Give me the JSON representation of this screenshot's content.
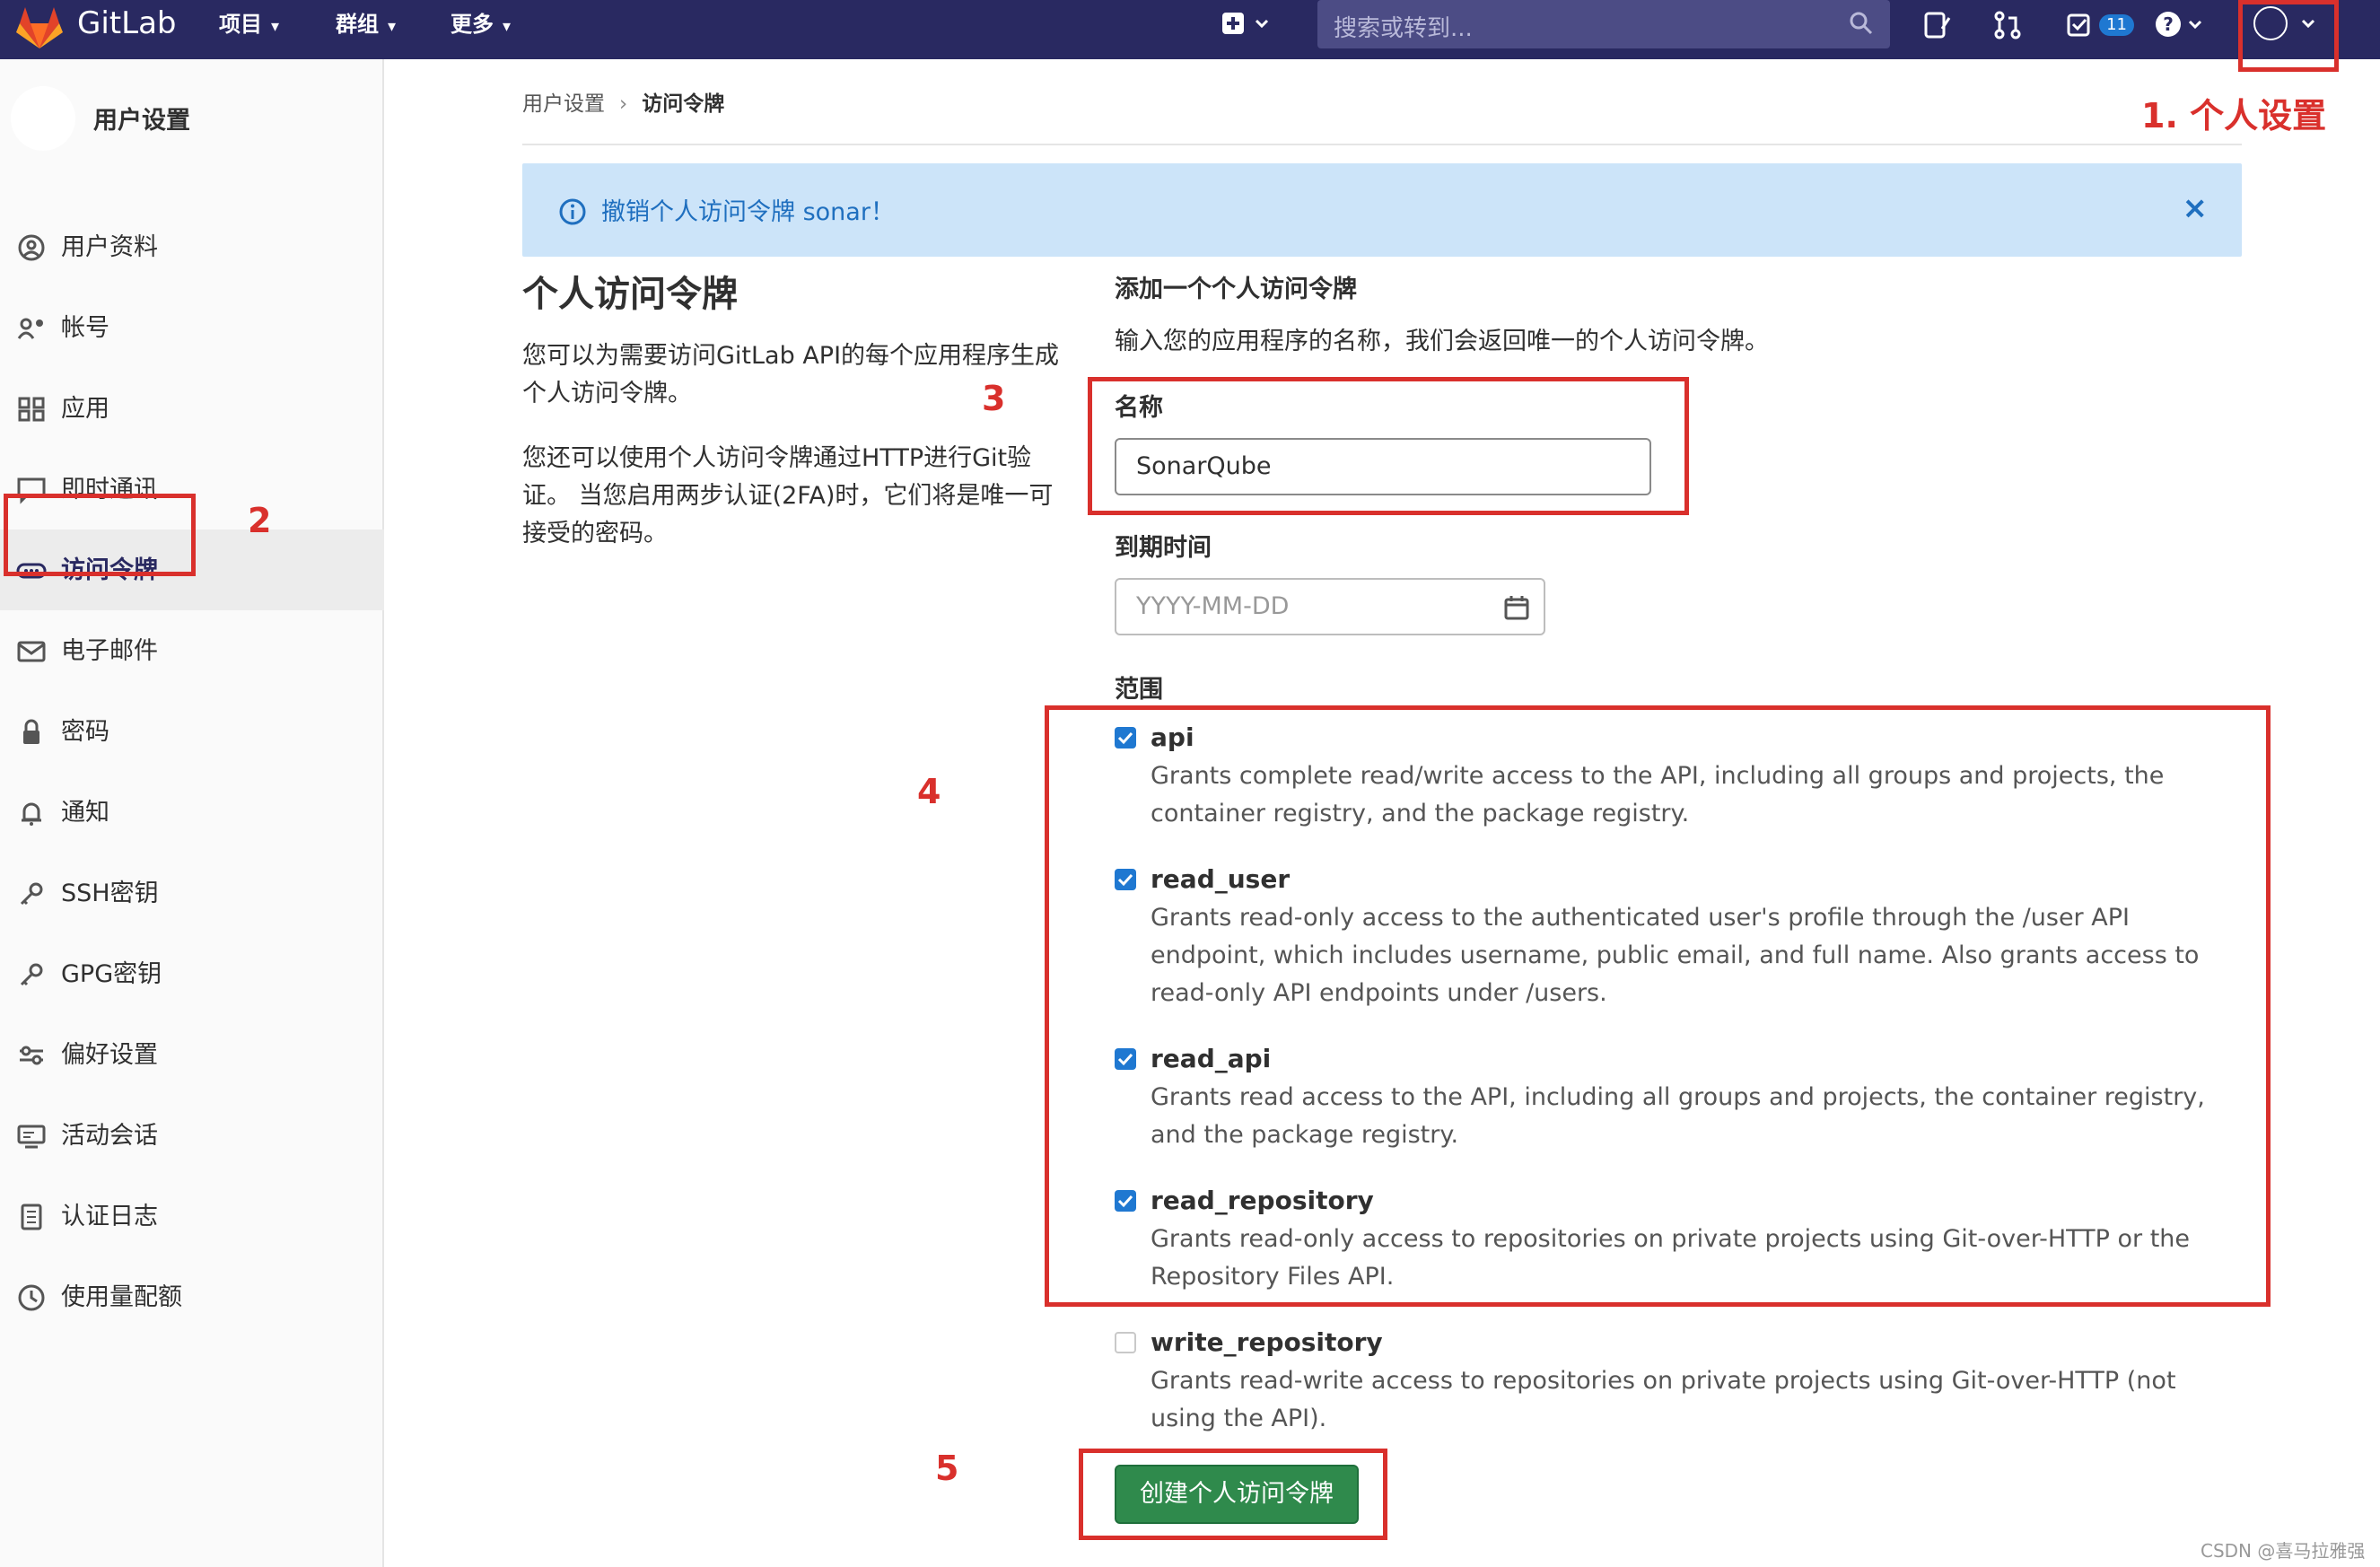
{
  "navbar": {
    "brand": "GitLab",
    "menus": [
      "项目",
      "群组",
      "更多"
    ],
    "search_placeholder": "搜索或转到...",
    "todo_count": "11"
  },
  "sidebar": {
    "title": "用户设置",
    "items": [
      {
        "label": "用户资料",
        "icon": "user-circle-icon"
      },
      {
        "label": "帐号",
        "icon": "account-gear-icon"
      },
      {
        "label": "应用",
        "icon": "apps-grid-icon"
      },
      {
        "label": "即时通讯",
        "icon": "chat-icon"
      },
      {
        "label": "访问令牌",
        "icon": "token-icon",
        "active": true
      },
      {
        "label": "电子邮件",
        "icon": "mail-icon"
      },
      {
        "label": "密码",
        "icon": "lock-icon"
      },
      {
        "label": "通知",
        "icon": "bell-icon"
      },
      {
        "label": "SSH密钥",
        "icon": "key-icon"
      },
      {
        "label": "GPG密钥",
        "icon": "key-icon"
      },
      {
        "label": "偏好设置",
        "icon": "sliders-icon"
      },
      {
        "label": "活动会话",
        "icon": "monitor-icon"
      },
      {
        "label": "认证日志",
        "icon": "log-icon"
      },
      {
        "label": "使用量配额",
        "icon": "quota-icon"
      }
    ]
  },
  "breadcrumb": {
    "parent": "用户设置",
    "current": "访问令牌"
  },
  "flash": {
    "message": "撤销个人访问令牌 sonar！",
    "close": "×"
  },
  "intro": {
    "heading": "个人访问令牌",
    "para1": "您可以为需要访问GitLab API的每个应用程序生成个人访问令牌。",
    "para2": "您还可以使用个人访问令牌通过HTTP进行Git验证。 当您启用两步认证(2FA)时，它们将是唯一可接受的密码。"
  },
  "form": {
    "title": "添加一个个人访问令牌",
    "description": "输入您的应用程序的名称，我们会返回唯一的个人访问令牌。",
    "name_label": "名称",
    "name_value": "SonarQube",
    "expires_label": "到期时间",
    "expires_placeholder": "YYYY-MM-DD",
    "scopes_label": "范围",
    "scopes": [
      {
        "name": "api",
        "checked": true,
        "desc": "Grants complete read/write access to the API, including all groups and projects, the container registry, and the package registry."
      },
      {
        "name": "read_user",
        "checked": true,
        "desc": "Grants read-only access to the authenticated user's profile through the /user API endpoint, which includes username, public email, and full name. Also grants access to read-only API endpoints under /users."
      },
      {
        "name": "read_api",
        "checked": true,
        "desc": "Grants read access to the API, including all groups and projects, the container registry, and the package registry."
      },
      {
        "name": "read_repository",
        "checked": true,
        "desc": "Grants read-only access to repositories on private projects using Git-over-HTTP or the Repository Files API."
      },
      {
        "name": "write_repository",
        "checked": false,
        "desc": "Grants read-write access to repositories on private projects using Git-over-HTTP (not using the API)."
      }
    ],
    "submit_label": "创建个人访问令牌"
  },
  "annotations": {
    "a1": "1. 个人设置",
    "a2": "2",
    "a3": "3",
    "a4": "4",
    "a5": "5"
  },
  "watermark": "CSDN @喜马拉雅强",
  "colors": {
    "navbar": "#292961",
    "flash_bg": "#cce4f9",
    "submit": "#2f8a4c",
    "annotation": "#d9302c",
    "checkbox": "#1f78d1"
  }
}
